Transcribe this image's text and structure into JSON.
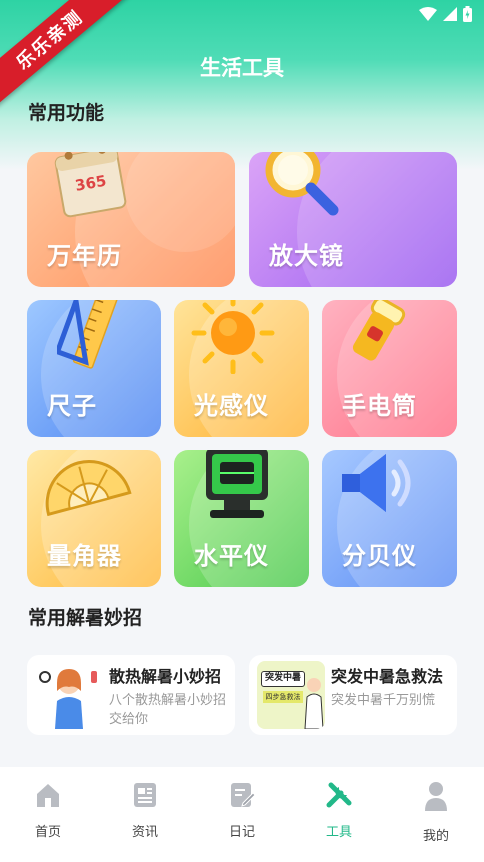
{
  "header": {
    "title": "生活工具",
    "ribbon": "乐乐亲测"
  },
  "sections": {
    "common": "常用功能",
    "tips": "常用解暑妙招"
  },
  "tools": [
    {
      "label": "万年历",
      "icon": "calendar-365-icon"
    },
    {
      "label": "放大镜",
      "icon": "magnifier-icon"
    },
    {
      "label": "尺子",
      "icon": "ruler-icon"
    },
    {
      "label": "光感仪",
      "icon": "sun-icon"
    },
    {
      "label": "手电筒",
      "icon": "flashlight-icon"
    },
    {
      "label": "量角器",
      "icon": "protractor-icon"
    },
    {
      "label": "水平仪",
      "icon": "laser-level-icon"
    },
    {
      "label": "分贝仪",
      "icon": "speaker-icon"
    }
  ],
  "calendar_number": "365",
  "tips": [
    {
      "title": "散热解暑小妙招",
      "desc": "八个散热解暑小妙招交给你"
    },
    {
      "title": "突发中暑急救法",
      "desc": "突发中暑千万别慌",
      "thumb_text": "突发中暑",
      "thumb_sub": "四步急救法"
    }
  ],
  "tabbar": [
    {
      "label": "首页",
      "icon": "home-icon"
    },
    {
      "label": "资讯",
      "icon": "news-icon"
    },
    {
      "label": "日记",
      "icon": "diary-icon"
    },
    {
      "label": "工具",
      "icon": "tools-icon"
    },
    {
      "label": "我的",
      "icon": "person-icon"
    }
  ],
  "colors": {
    "accent": "#22b889",
    "header": "#2ed3a4"
  }
}
